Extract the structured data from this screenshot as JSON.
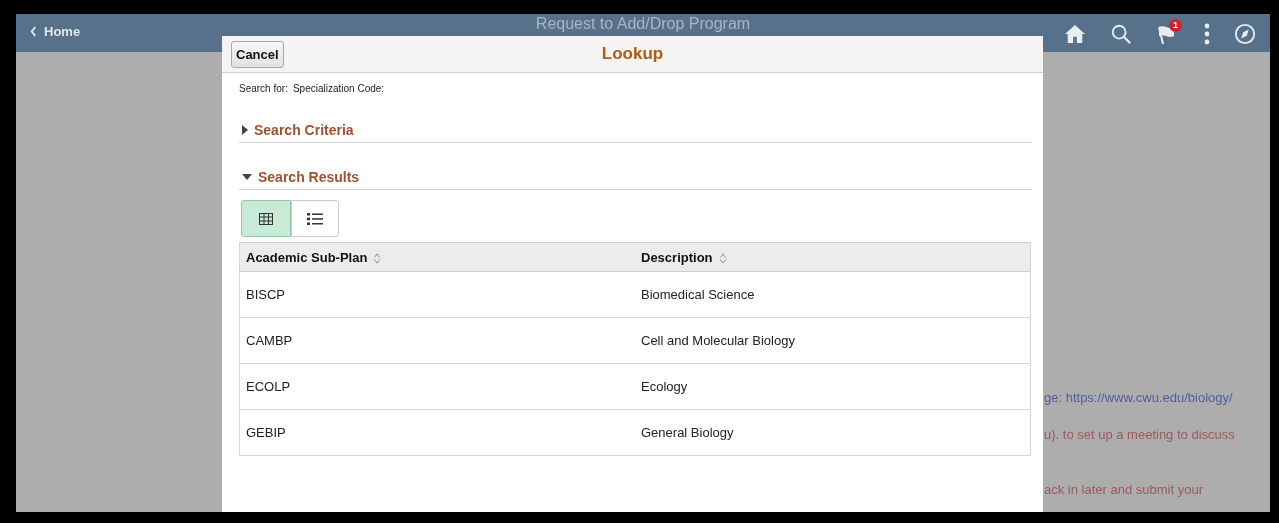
{
  "header": {
    "back_label": "Home",
    "title": "Request to Add/Drop Program",
    "notification_count": "1"
  },
  "background_text": [
    {
      "kind": "link",
      "text": "ge: https://www.cwu.edu/biology/"
    },
    {
      "kind": "plain",
      "text": "u).  to set up a meeting to discuss"
    },
    {
      "kind": "plain",
      "text": "ack in later and submit your"
    }
  ],
  "lookup": {
    "title": "Lookup",
    "cancel": "Cancel",
    "search_for_label": "Search for:",
    "search_for_value": "Specialization Code:",
    "sections": [
      {
        "label": "Search Criteria",
        "expanded": false
      },
      {
        "label": "Search Results",
        "expanded": true
      }
    ],
    "views": [
      {
        "kind": "grid",
        "selected": true
      },
      {
        "kind": "list",
        "selected": false
      }
    ],
    "table": {
      "columns": [
        "Academic Sub-Plan",
        "Description"
      ],
      "rows": [
        [
          "BISCP",
          "Biomedical Science"
        ],
        [
          "CAMBP",
          "Cell and Molecular Biology"
        ],
        [
          "ECOLP",
          "Ecology"
        ],
        [
          "GEBIP",
          "General Biology"
        ]
      ]
    }
  }
}
